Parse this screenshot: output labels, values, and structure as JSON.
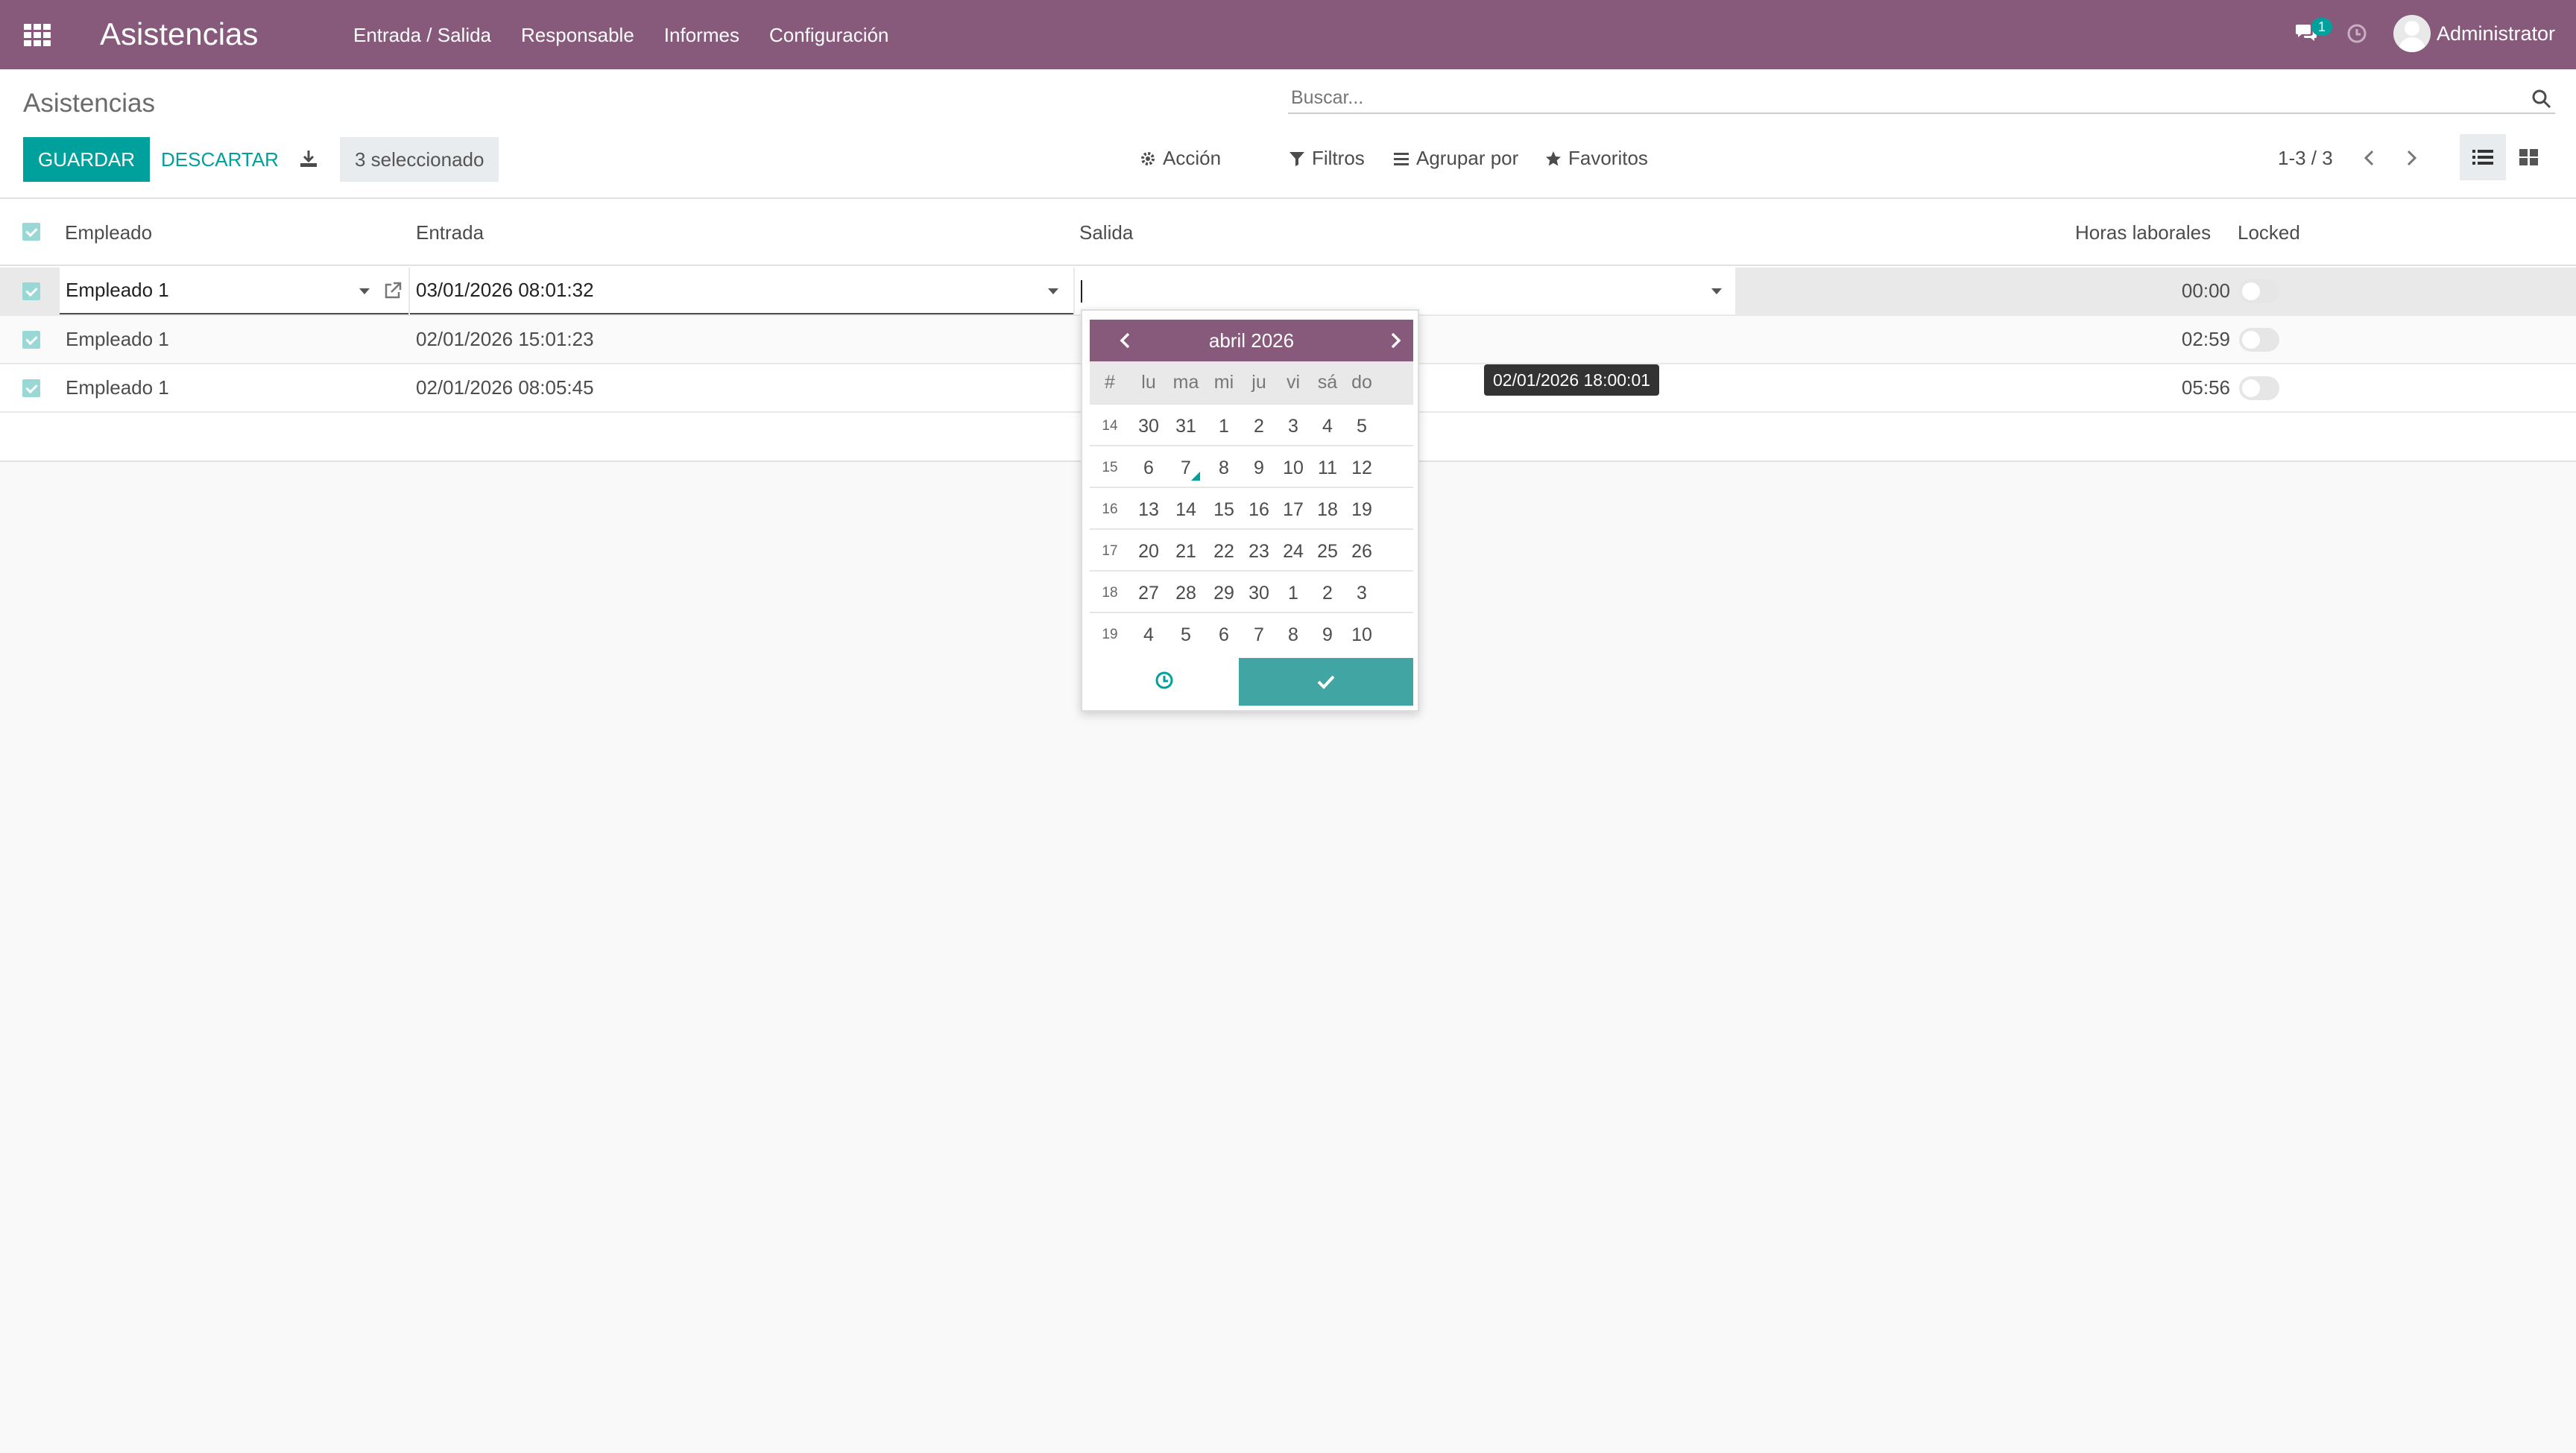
{
  "navbar": {
    "app_title": "Asistencias",
    "menu": [
      "Entrada / Salida",
      "Responsable",
      "Informes",
      "Configuración"
    ],
    "messages_count": "1",
    "user_name": "Administrator",
    "accent_color": "#875a7b"
  },
  "control": {
    "page_title": "Asistencias",
    "search_placeholder": "Buscar...",
    "save_label": "GUARDAR",
    "discard_label": "DESCARTAR",
    "selected_label": "3 seleccionado",
    "action_label": "Acción",
    "filters_label": "Filtros",
    "groupby_label": "Agrupar por",
    "favorites_label": "Favoritos",
    "pager": "1-3 / 3"
  },
  "table": {
    "headers": {
      "employee": "Empleado",
      "check_in": "Entrada",
      "check_out": "Salida",
      "worked_hours": "Horas laborales",
      "locked": "Locked"
    },
    "rows": [
      {
        "employee": "Empleado 1",
        "check_in": "03/01/2026 08:01:32",
        "check_out": "",
        "worked_hours": "00:00",
        "locked": false
      },
      {
        "employee": "Empleado 1",
        "check_in": "02/01/2026 15:01:23",
        "check_out": "",
        "worked_hours": "02:59",
        "locked": false
      },
      {
        "employee": "Empleado 1",
        "check_in": "02/01/2026 08:05:45",
        "check_out": "",
        "worked_hours": "05:56",
        "locked": false
      }
    ]
  },
  "tooltip": "02/01/2026 18:00:01",
  "datepicker": {
    "month_label": "abril 2026",
    "dow": [
      "#",
      "lu",
      "ma",
      "mi",
      "ju",
      "vi",
      "sá",
      "do"
    ],
    "weeks": [
      [
        "14",
        "30",
        "31",
        "1",
        "2",
        "3",
        "4",
        "5"
      ],
      [
        "15",
        "6",
        "7",
        "8",
        "9",
        "10",
        "11",
        "12"
      ],
      [
        "16",
        "13",
        "14",
        "15",
        "16",
        "17",
        "18",
        "19"
      ],
      [
        "17",
        "20",
        "21",
        "22",
        "23",
        "24",
        "25",
        "26"
      ],
      [
        "18",
        "27",
        "28",
        "29",
        "30",
        "1",
        "2",
        "3"
      ],
      [
        "19",
        "4",
        "5",
        "6",
        "7",
        "8",
        "9",
        "10"
      ]
    ],
    "today": "7"
  }
}
